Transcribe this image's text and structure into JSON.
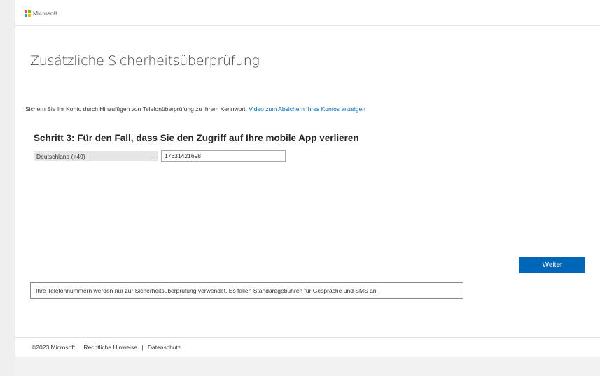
{
  "header": {
    "logo_text": "Microsoft",
    "logo_colors": [
      "#f25022",
      "#7fba00",
      "#00a4ef",
      "#ffb900"
    ]
  },
  "main": {
    "title": "Zusätzliche Sicherheitsüberprüfung",
    "intro_text": "Sichern Sie Ihr Konto durch Hinzufügen von Telefonüberprüfung zu Ihrem Kennwort.",
    "intro_link": "Video zum Absichern Ihres Kontos anzeigen",
    "step_heading": "Schritt 3: Für den Fall, dass Sie den Zugriff auf Ihre mobile App verlieren",
    "country_select": {
      "value": "Deutschland (+49)",
      "icon": "chevron-down-icon"
    },
    "phone_input": {
      "value": "17631421698"
    },
    "next_button": "Weiter",
    "notice": "Ihre Telefonnummern werden nur zur Sicherheitsüberprüfung verwendet. Es fallen Standardgebühren für Gespräche und SMS an."
  },
  "footer": {
    "copyright": "©2023 Microsoft",
    "legal_link": "Rechtliche Hinweise",
    "separator": "|",
    "privacy_link": "Datenschutz"
  },
  "colors": {
    "accent": "#0067b8",
    "link": "#0067b8"
  }
}
